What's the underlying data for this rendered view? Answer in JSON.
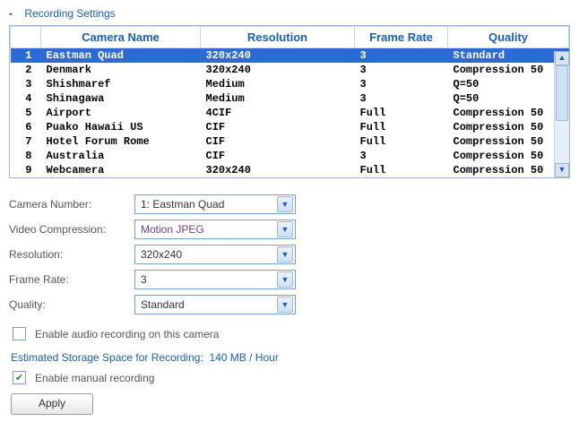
{
  "section_title": "Recording Settings",
  "table": {
    "headers": [
      "",
      "Camera Name",
      "Resolution",
      "Frame Rate",
      "Quality"
    ],
    "col_widths": [
      "34px",
      "170px",
      "170px",
      "100px",
      "auto"
    ],
    "selected_index": 0,
    "rows": [
      {
        "n": "1",
        "name": "Eastman Quad",
        "res": "320x240",
        "fr": "3",
        "q": "Standard"
      },
      {
        "n": "2",
        "name": "Denmark",
        "res": "320x240",
        "fr": "3",
        "q": "Compression 50"
      },
      {
        "n": "3",
        "name": "Shishmaref",
        "res": "Medium",
        "fr": "3",
        "q": "Q=50"
      },
      {
        "n": "4",
        "name": "Shinagawa",
        "res": "Medium",
        "fr": "3",
        "q": "Q=50"
      },
      {
        "n": "5",
        "name": "Airport",
        "res": "4CIF",
        "fr": "Full",
        "q": "Compression 50"
      },
      {
        "n": "6",
        "name": "Puako Hawaii US",
        "res": "CIF",
        "fr": "Full",
        "q": "Compression 50"
      },
      {
        "n": "7",
        "name": "Hotel Forum Rome",
        "res": "CIF",
        "fr": "Full",
        "q": "Compression 50"
      },
      {
        "n": "8",
        "name": "Australia",
        "res": "CIF",
        "fr": "3",
        "q": "Compression 50"
      },
      {
        "n": "9",
        "name": "Webcamera",
        "res": "320x240",
        "fr": "Full",
        "q": "Compression 50"
      }
    ]
  },
  "form": {
    "camera_number": {
      "label": "Camera Number:",
      "value": "1: Eastman Quad"
    },
    "video_compression": {
      "label": "Video Compression:",
      "value": "Motion JPEG"
    },
    "resolution": {
      "label": "Resolution:",
      "value": "320x240"
    },
    "frame_rate": {
      "label": "Frame Rate:",
      "value": "3"
    },
    "quality": {
      "label": "Quality:",
      "value": "Standard"
    }
  },
  "enable_audio": {
    "label": "Enable audio recording on this camera",
    "checked": false
  },
  "estimate": {
    "label": "Estimated Storage Space for Recording:",
    "value": "140 MB / Hour"
  },
  "enable_manual": {
    "label": "Enable manual recording",
    "checked": true
  },
  "apply_label": "Apply"
}
